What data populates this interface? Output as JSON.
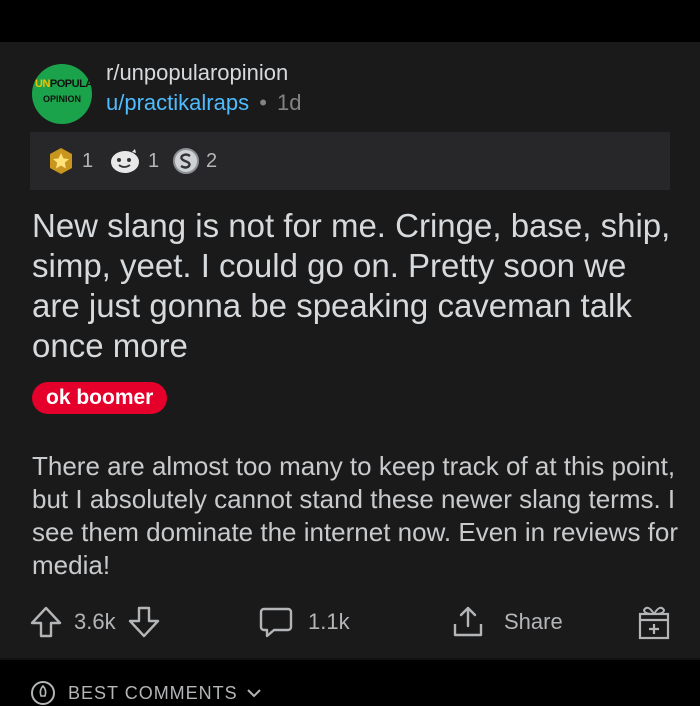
{
  "post": {
    "subreddit": "r/unpopularopinion",
    "subreddit_logo": {
      "line1_un": "UN",
      "line1_rest": "POPULAR",
      "line2": "OPINION"
    },
    "user": "u/practikalraps",
    "separator": "•",
    "age": "1d",
    "awards": [
      {
        "icon": "gold-star-award-icon",
        "count": "1"
      },
      {
        "icon": "wholesome-award-icon",
        "count": "1"
      },
      {
        "icon": "silver-s-award-icon",
        "count": "2"
      }
    ],
    "title": "New slang is not for me. Cringe, base, ship, simp, yeet. I could go on. Pretty soon we are just gonna be speaking caveman talk once more",
    "flair": "ok boomer",
    "body": "There are almost too many to keep track of at this point, but I absolutely cannot stand these newer slang terms. I see them dominate the internet now. Even in reviews for media!",
    "actions": {
      "upvotes": "3.6k",
      "comments": "1.1k",
      "share": "Share"
    },
    "sort_label": "BEST COMMENTS"
  },
  "colors": {
    "card": "#1a1a1b",
    "link": "#4fbcff",
    "flair": "#e4002b",
    "logo": "#1aa34a"
  }
}
